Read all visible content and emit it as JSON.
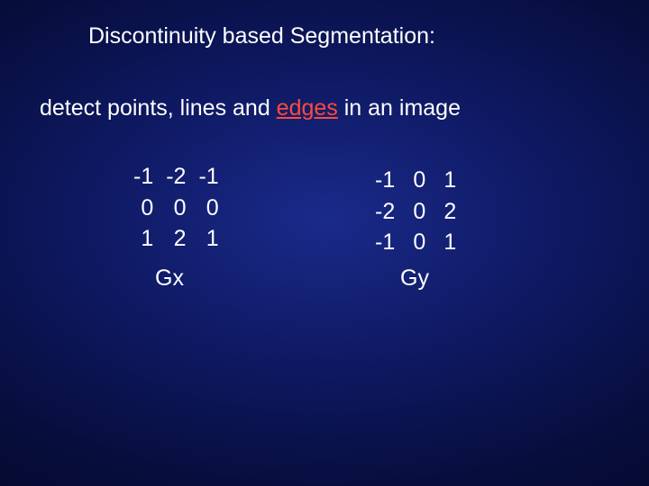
{
  "title": "Discontinuity based Segmentation:",
  "subtitle_pre": "detect points, lines and ",
  "subtitle_edge": "edges",
  "subtitle_post": " in an image",
  "gx": {
    "label": "Gx",
    "r0c0": "-1",
    "r0c1": "-2",
    "r0c2": "-1",
    "r1c0": "0",
    "r1c1": "0",
    "r1c2": "0",
    "r2c0": "1",
    "r2c1": "2",
    "r2c2": "1"
  },
  "gy": {
    "label": "Gy",
    "r0c0": "-1",
    "r0c1": "0",
    "r0c2": "1",
    "r1c0": "-2",
    "r1c1": "0",
    "r1c2": "2",
    "r2c0": "-1",
    "r2c1": "0",
    "r2c2": "1"
  }
}
